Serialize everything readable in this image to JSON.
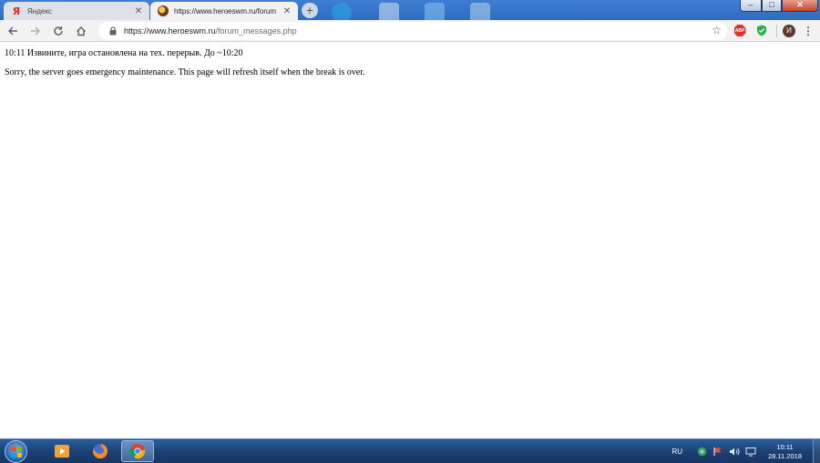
{
  "browser": {
    "tabs": [
      {
        "title": "Яндекс",
        "favicon": "yandex-favicon",
        "active": false,
        "close": "✕"
      },
      {
        "title": "https://www.heroeswm.ru/forum",
        "favicon": "heroeswm-favicon",
        "active": true,
        "close": "✕"
      }
    ],
    "new_tab_label": "+",
    "window_buttons": {
      "minimize": "–",
      "maximize": "□",
      "close": "✕"
    },
    "address": {
      "host": "https://www.heroeswm.ru",
      "path": "/forum_messages.php"
    },
    "extensions": {
      "adblock_label": "ABP",
      "profile_initial": "И"
    }
  },
  "page": {
    "lines": [
      "10:11 Извините, игра остановлена на тех. перерыв. До ~10:20",
      "Sorry, the server goes emergency maintenance. This page will refresh itself when the break is over."
    ]
  },
  "taskbar": {
    "language": "RU",
    "time": "10:11",
    "date": "28.11.2018"
  },
  "colors": {
    "taskbar": "#1b3f72",
    "tabstrip": "#3f7fd3",
    "active_tab": "#f2f2f2",
    "abp_red": "#e0312c",
    "shield_green": "#2fae4b"
  }
}
